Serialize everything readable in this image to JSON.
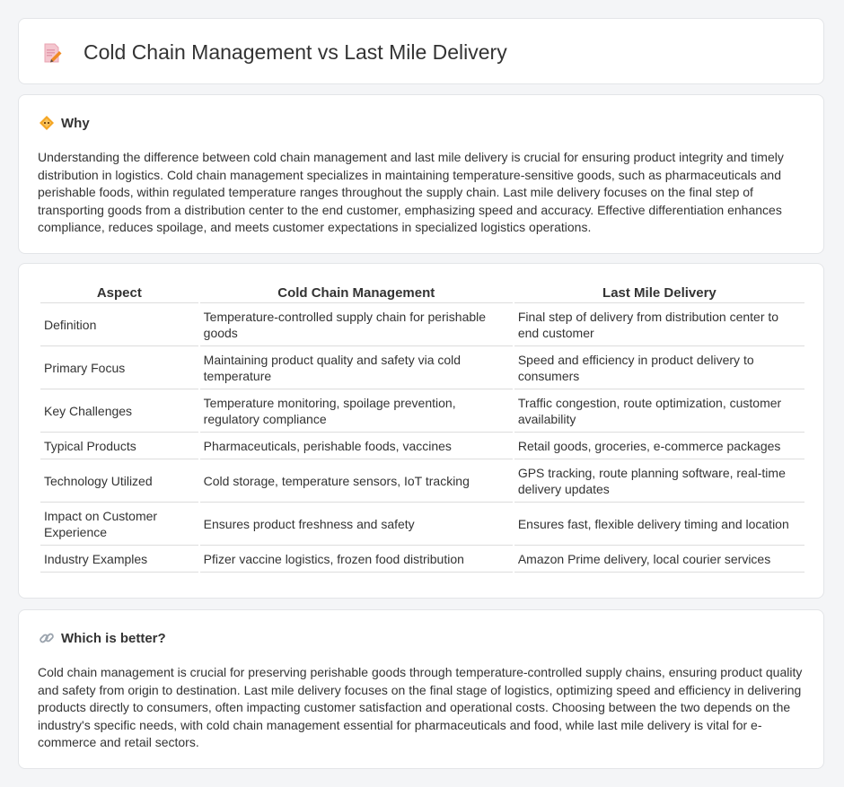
{
  "page": {
    "title": "Cold Chain Management vs Last Mile Delivery"
  },
  "why": {
    "heading": "Why",
    "text": "Understanding the difference between cold chain management and last mile delivery is crucial for ensuring product integrity and timely distribution in logistics. Cold chain management specializes in maintaining temperature-sensitive goods, such as pharmaceuticals and perishable foods, within regulated temperature ranges throughout the supply chain. Last mile delivery focuses on the final step of transporting goods from a distribution center to the end customer, emphasizing speed and accuracy. Effective differentiation enhances compliance, reduces spoilage, and meets customer expectations in specialized logistics operations."
  },
  "table": {
    "headers": [
      "Aspect",
      "Cold Chain Management",
      "Last Mile Delivery"
    ],
    "rows": [
      [
        "Definition",
        "Temperature-controlled supply chain for perishable goods",
        "Final step of delivery from distribution center to end customer"
      ],
      [
        "Primary Focus",
        "Maintaining product quality and safety via cold temperature",
        "Speed and efficiency in product delivery to consumers"
      ],
      [
        "Key Challenges",
        "Temperature monitoring, spoilage prevention, regulatory compliance",
        "Traffic congestion, route optimization, customer availability"
      ],
      [
        "Typical Products",
        "Pharmaceuticals, perishable foods, vaccines",
        "Retail goods, groceries, e-commerce packages"
      ],
      [
        "Technology Utilized",
        "Cold storage, temperature sensors, IoT tracking",
        "GPS tracking, route planning software, real-time delivery updates"
      ],
      [
        "Impact on Customer Experience",
        "Ensures product freshness and safety",
        "Ensures fast, flexible delivery timing and location"
      ],
      [
        "Industry Examples",
        "Pfizer vaccine logistics, frozen food distribution",
        "Amazon Prime delivery, local courier services"
      ]
    ]
  },
  "better": {
    "heading": "Which is better?",
    "text": "Cold chain management is crucial for preserving perishable goods through temperature-controlled supply chains, ensuring product quality and safety from origin to destination. Last mile delivery focuses on the final stage of logistics, optimizing speed and efficiency in delivering products directly to consumers, often impacting customer satisfaction and operational costs. Choosing between the two depends on the industry's specific needs, with cold chain management essential for pharmaceuticals and food, while last mile delivery is vital for e-commerce and retail sectors."
  },
  "icons": {
    "title": "document-pencil-icon",
    "why": "diamond-warning-icon",
    "better": "link-icon"
  },
  "colors": {
    "accent_orange": "#f08a24",
    "doc_pink": "#f4b9c7"
  }
}
